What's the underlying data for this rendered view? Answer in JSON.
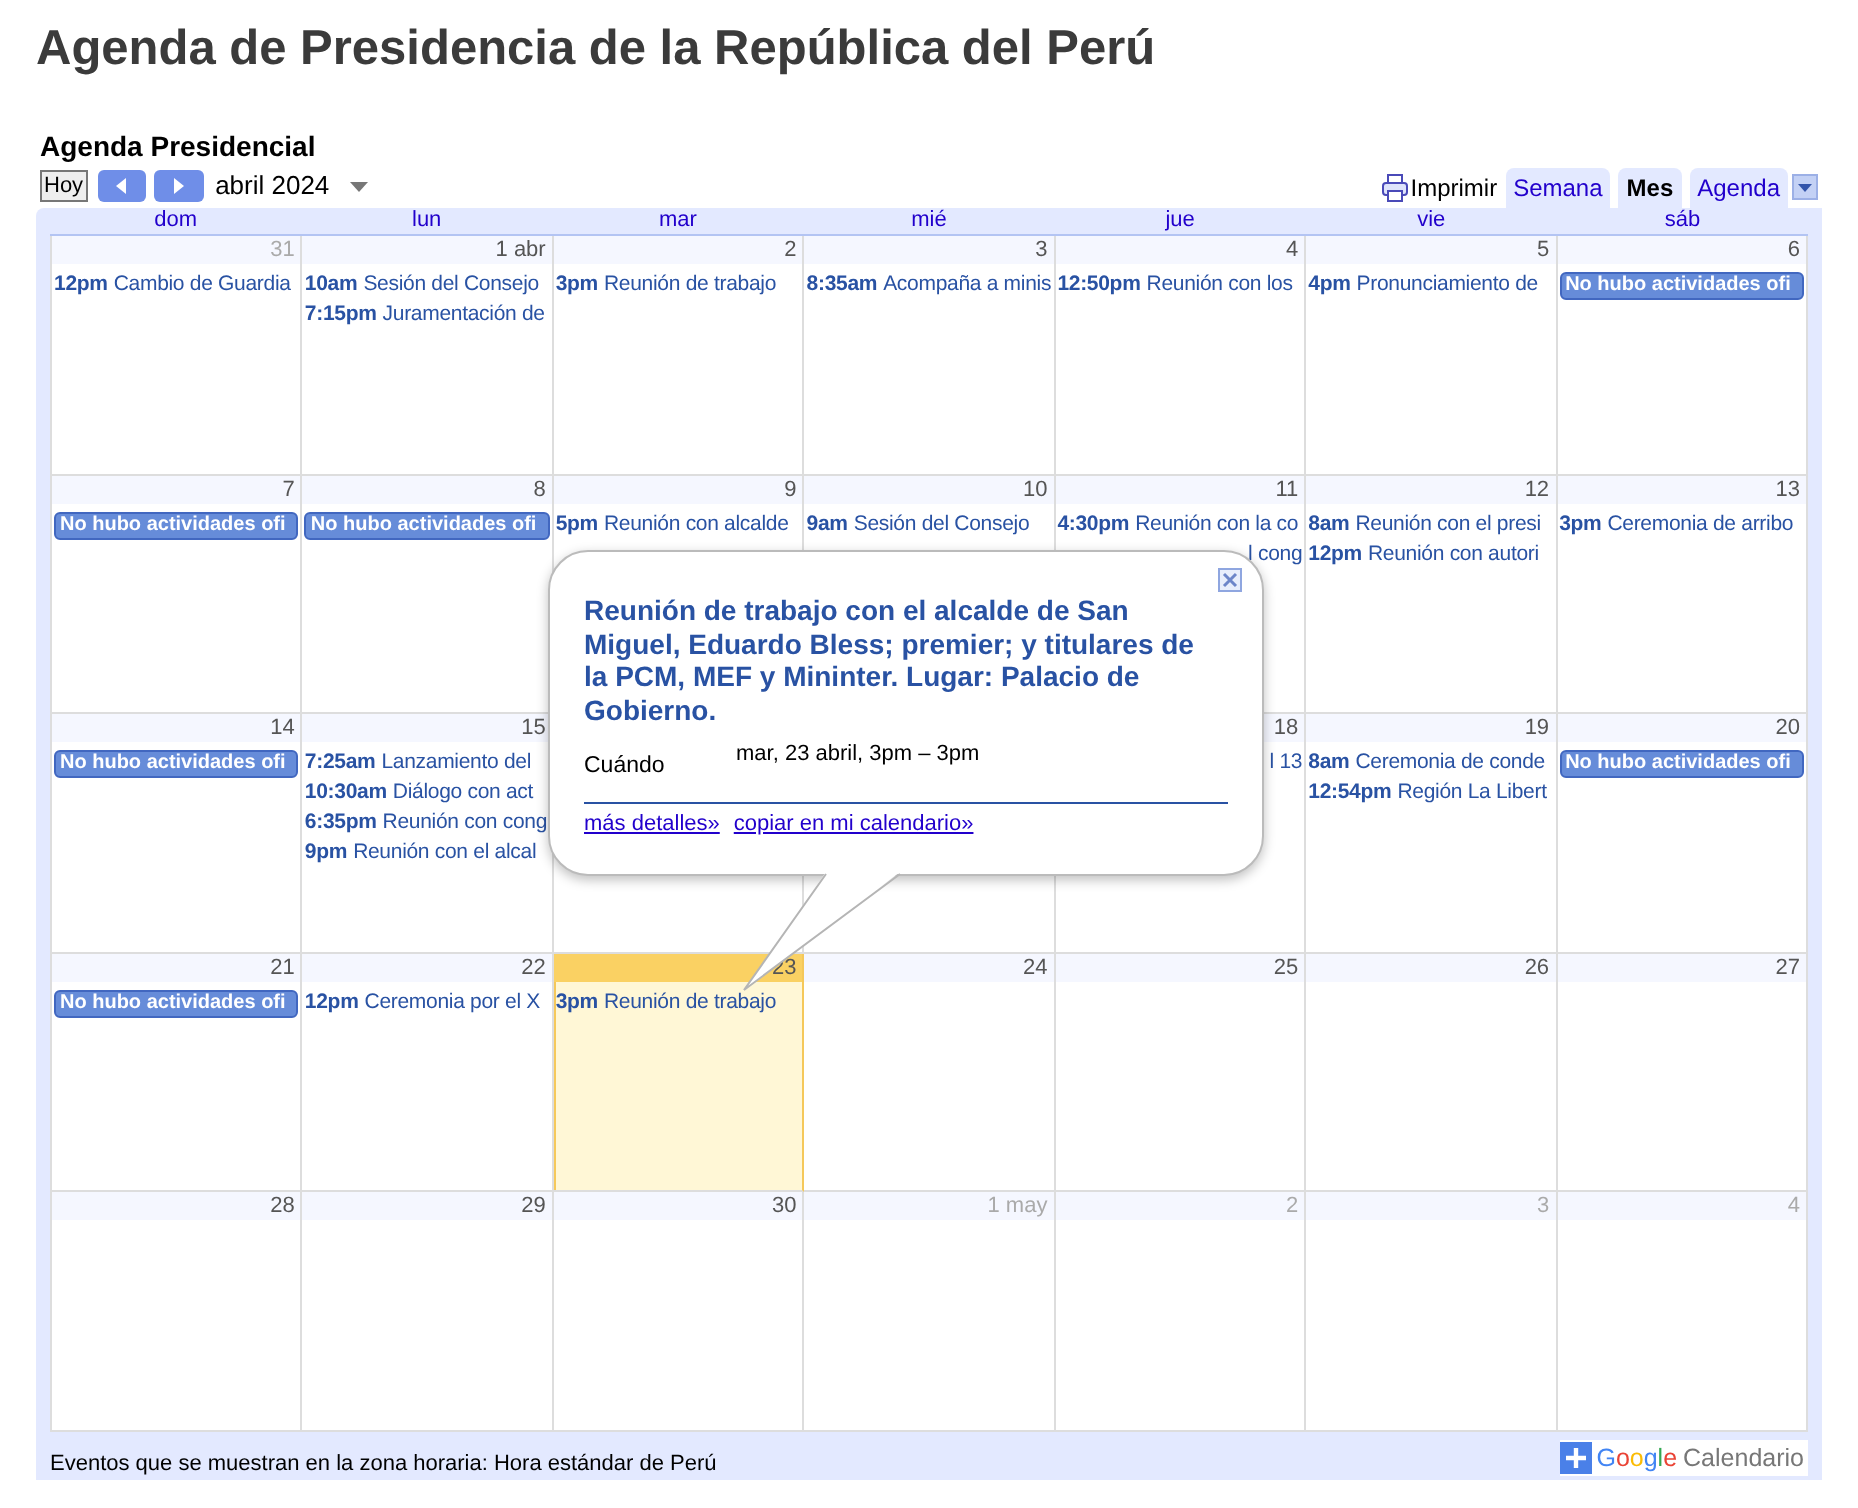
{
  "page_title": "Agenda de Presidencia de la República del Perú",
  "calendar": {
    "title": "Agenda Presidencial",
    "today_button": "Hoy",
    "period_label": "abril 2024",
    "print_label": "Imprimir",
    "view_tabs": [
      {
        "label": "Semana",
        "selected": false
      },
      {
        "label": "Mes",
        "selected": true
      },
      {
        "label": "Agenda",
        "selected": false
      }
    ],
    "weekdays": [
      "dom",
      "lun",
      "mar",
      "mié",
      "jue",
      "vie",
      "sáb"
    ],
    "weeks": [
      [
        {
          "date": "31",
          "other_month": true,
          "today": false,
          "events": [
            {
              "kind": "timed",
              "time": "12pm",
              "title": "Cambio de Guardia"
            }
          ]
        },
        {
          "date": "1 abr",
          "other_month": false,
          "today": false,
          "events": [
            {
              "kind": "timed",
              "time": "10am",
              "title": "Sesión del Consejo"
            },
            {
              "kind": "timed",
              "time": "7:15pm",
              "title": "Juramentación de"
            }
          ]
        },
        {
          "date": "2",
          "other_month": false,
          "today": false,
          "events": [
            {
              "kind": "timed",
              "time": "3pm",
              "title": "Reunión de trabajo"
            }
          ]
        },
        {
          "date": "3",
          "other_month": false,
          "today": false,
          "events": [
            {
              "kind": "timed",
              "time": "8:35am",
              "title": "Acompaña a minis"
            }
          ]
        },
        {
          "date": "4",
          "other_month": false,
          "today": false,
          "events": [
            {
              "kind": "timed",
              "time": "12:50pm",
              "title": "Reunión con los"
            }
          ]
        },
        {
          "date": "5",
          "other_month": false,
          "today": false,
          "events": [
            {
              "kind": "timed",
              "time": "4pm",
              "title": "Pronunciamiento de"
            }
          ]
        },
        {
          "date": "6",
          "other_month": false,
          "today": false,
          "events": [
            {
              "kind": "all_day",
              "title": "No hubo actividades ofi"
            }
          ]
        }
      ],
      [
        {
          "date": "7",
          "other_month": false,
          "today": false,
          "events": [
            {
              "kind": "all_day",
              "title": "No hubo actividades ofi"
            }
          ]
        },
        {
          "date": "8",
          "other_month": false,
          "today": false,
          "events": [
            {
              "kind": "all_day",
              "title": "No hubo actividades ofi"
            }
          ]
        },
        {
          "date": "9",
          "other_month": false,
          "today": false,
          "events": [
            {
              "kind": "timed",
              "time": "5pm",
              "title": "Reunión con alcalde"
            }
          ]
        },
        {
          "date": "10",
          "other_month": false,
          "today": false,
          "events": [
            {
              "kind": "timed",
              "time": "9am",
              "title": "Sesión del Consejo"
            }
          ]
        },
        {
          "date": "11",
          "other_month": false,
          "today": false,
          "events": [
            {
              "kind": "timed",
              "time": "4:30pm",
              "title": "Reunión con la co"
            },
            {
              "kind": "fragment",
              "title": "l cong"
            }
          ]
        },
        {
          "date": "12",
          "other_month": false,
          "today": false,
          "events": [
            {
              "kind": "timed",
              "time": "8am",
              "title": "Reunión con el presi"
            },
            {
              "kind": "timed",
              "time": "12pm",
              "title": "Reunión con autori"
            }
          ]
        },
        {
          "date": "13",
          "other_month": false,
          "today": false,
          "events": [
            {
              "kind": "timed",
              "time": "3pm",
              "title": "Ceremonia de arribo"
            }
          ]
        }
      ],
      [
        {
          "date": "14",
          "other_month": false,
          "today": false,
          "events": [
            {
              "kind": "all_day",
              "title": "No hubo actividades ofi"
            }
          ]
        },
        {
          "date": "15",
          "other_month": false,
          "today": false,
          "events": [
            {
              "kind": "timed",
              "time": "7:25am",
              "title": "Lanzamiento del"
            },
            {
              "kind": "timed",
              "time": "10:30am",
              "title": "Diálogo con act"
            },
            {
              "kind": "timed",
              "time": "6:35pm",
              "title": "Reunión con cong"
            },
            {
              "kind": "timed",
              "time": "9pm",
              "title": "Reunión con el alcal"
            }
          ]
        },
        {
          "covered": true
        },
        {
          "covered": true
        },
        {
          "date": "18",
          "other_month": false,
          "today": false,
          "events": [
            {
              "kind": "fragment",
              "title": "l 13"
            }
          ]
        },
        {
          "date": "19",
          "other_month": false,
          "today": false,
          "events": [
            {
              "kind": "timed",
              "time": "8am",
              "title": "Ceremonia de conde"
            },
            {
              "kind": "timed",
              "time": "12:54pm",
              "title": "Región La Libert"
            }
          ]
        },
        {
          "date": "20",
          "other_month": false,
          "today": false,
          "events": [
            {
              "kind": "all_day",
              "title": "No hubo actividades ofi"
            }
          ]
        }
      ],
      [
        {
          "date": "21",
          "other_month": false,
          "today": false,
          "events": [
            {
              "kind": "all_day",
              "title": "No hubo actividades ofi"
            }
          ]
        },
        {
          "date": "22",
          "other_month": false,
          "today": false,
          "events": [
            {
              "kind": "timed",
              "time": "12pm",
              "title": "Ceremonia por el X"
            }
          ]
        },
        {
          "date": "23",
          "other_month": false,
          "today": true,
          "events": [
            {
              "kind": "timed",
              "time": "3pm",
              "title": "Reunión de trabajo"
            }
          ]
        },
        {
          "date": "24",
          "other_month": false,
          "today": false
        },
        {
          "date": "25",
          "other_month": false,
          "today": false
        },
        {
          "date": "26",
          "other_month": false,
          "today": false
        },
        {
          "date": "27",
          "other_month": false,
          "today": false
        }
      ],
      [
        {
          "date": "28",
          "other_month": false,
          "today": false
        },
        {
          "date": "29",
          "other_month": false,
          "today": false
        },
        {
          "date": "30",
          "other_month": false,
          "today": false
        },
        {
          "date": "1 may",
          "other_month": true,
          "today": false
        },
        {
          "date": "2",
          "other_month": true,
          "today": false
        },
        {
          "date": "3",
          "other_month": true,
          "today": false
        },
        {
          "date": "4",
          "other_month": true,
          "today": false
        }
      ]
    ]
  },
  "event_popup": {
    "title": "Reunión de trabajo con el alcalde de San Miguel, Eduardo Bless; premier; y titulares de la PCM, MEF y Mininter. Lugar: Palacio de Gobierno.",
    "when_label": "Cuándo",
    "when_value": "mar, 23 abril, 3pm – 3pm",
    "links": [
      "más detalles»",
      "copiar en mi calendario»"
    ]
  },
  "footer": {
    "timezone_note": "Eventos que se muestran en la zona horaria: Hora estándar de Perú",
    "badge": {
      "brand": "Google",
      "label": "Calendario"
    }
  }
}
